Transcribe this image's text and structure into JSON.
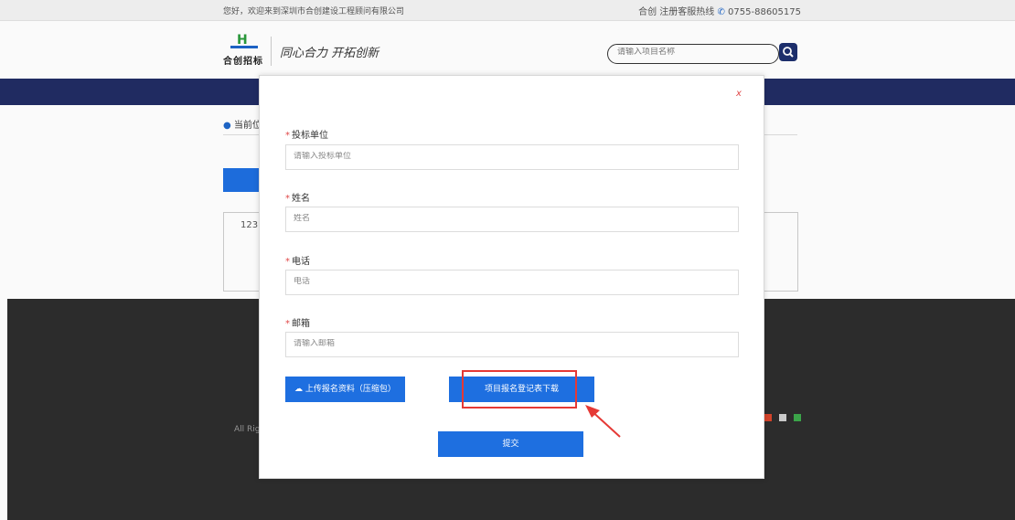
{
  "topbar": {
    "welcome": "您好，欢迎来到深圳市合创建设工程顾问有限公司",
    "hotline_label": "合创 注册客服热线",
    "hotline_number": "0755-88605175"
  },
  "header": {
    "logo_mark": "H",
    "logo_text": "合创招标",
    "slogan": "同心合力 开拓创新",
    "search_placeholder": "请输入项目名称"
  },
  "background": {
    "location_label": "当前位",
    "box_value": "123",
    "footer_rights": "All Right"
  },
  "modal": {
    "close_label": "x",
    "fields": [
      {
        "label": "投标单位",
        "placeholder": "请输入投标单位"
      },
      {
        "label": "姓名",
        "placeholder": "姓名"
      },
      {
        "label": "电话",
        "placeholder": "电话"
      },
      {
        "label": "邮箱",
        "placeholder": "请输入邮箱"
      }
    ],
    "required_mark": "*",
    "upload_label": "上传报名资料（压缩包）",
    "download_label": "项目报名登记表下载",
    "submit_label": "提交"
  },
  "colors": {
    "nav": "#212c63",
    "primary": "#1e6fe0",
    "highlight": "#e53935",
    "footer": "#2d2d2d"
  }
}
